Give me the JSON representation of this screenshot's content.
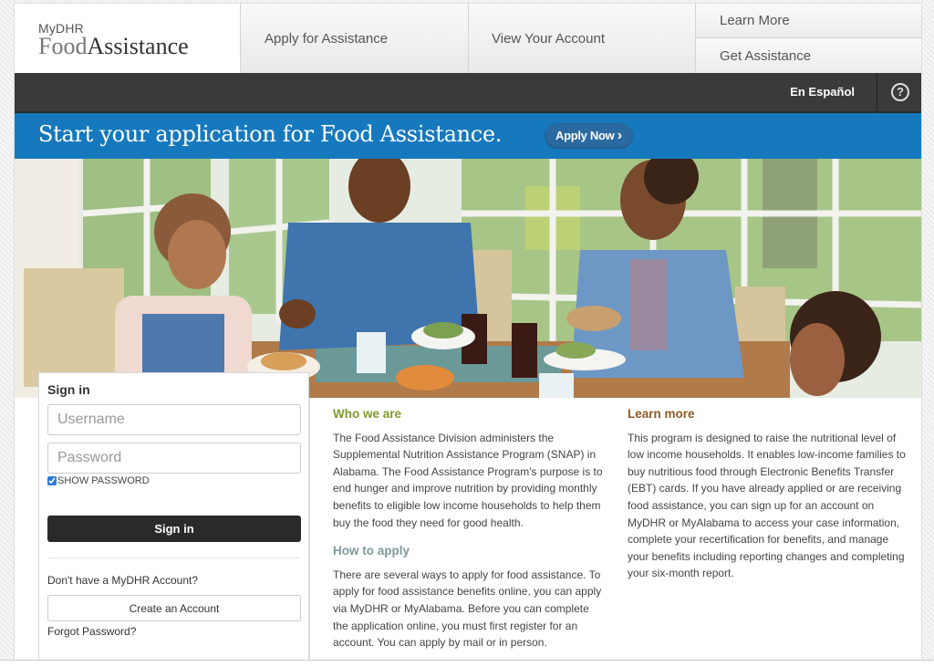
{
  "brand": {
    "top": "MyDHR",
    "food": "Food",
    "assistance": "Assistance"
  },
  "nav": {
    "apply": "Apply for Assistance",
    "view": "View Your Account",
    "learn_more": "Learn More",
    "get_assistance": "Get Assistance"
  },
  "utility_bar": {
    "espanol": "En Español",
    "help_icon": "?"
  },
  "banner": {
    "title": "Start your application for Food Assistance.",
    "button": "Apply Now",
    "button_icon": "›",
    "color": "#1679bd"
  },
  "hero": {
    "alt": "Family eating a meal together at a table"
  },
  "signin": {
    "title": "Sign in",
    "username_placeholder": "Username",
    "password_placeholder": "Password",
    "show_password_label": "SHOW PASSWORD",
    "show_password_checked": true,
    "signin_button": "Sign in",
    "no_account_text": "Don't have a MyDHR Account?",
    "create_button": "Create an Account",
    "forgot_link": "Forgot Password?"
  },
  "who_we_are": {
    "heading": "Who we are",
    "body": "The Food Assistance Division administers the Supplemental Nutrition Assistance Program (SNAP) in Alabama.  The Food Assistance Program's purpose is to end hunger and improve nutrition by providing monthly benefits to eligible low income households to help them buy the food they need for good health."
  },
  "how_to_apply": {
    "heading": "How to apply",
    "body": "There are several ways to apply for food assistance. To apply for food assistance benefits online, you can apply via MyDHR or MyAlabama. Before you can complete the application online, you must first register for an account. You can apply by mail or in person."
  },
  "learn_more": {
    "heading": "Learn more",
    "body": "This program is designed to raise the nutritional level of low income households. It enables low-income families to buy nutritious food through Electronic Benefits Transfer (EBT) cards. If you have already applied or are receiving food assistance, you can sign up for an account on MyDHR or MyAlabama to access your case information, complete your recertification for benefits, and manage your benefits including reporting changes and completing your six-month report."
  }
}
